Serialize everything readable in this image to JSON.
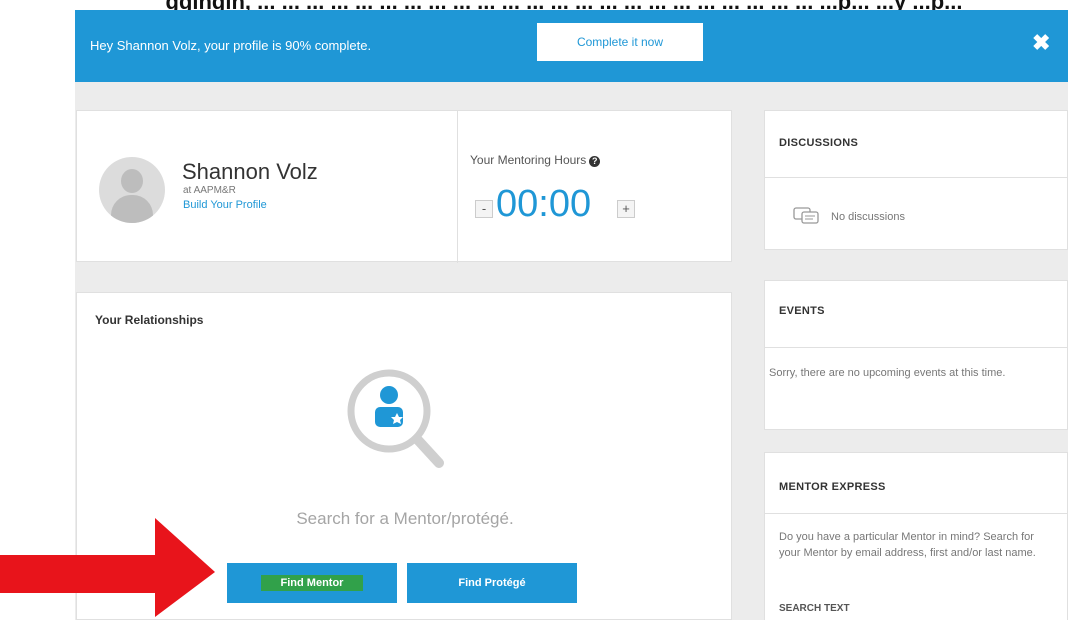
{
  "caption_fragment": "ggingin, ... ... ... ... ... ... ... ... ... ... ... ... ... ... ... ... ... ... ... ... ... ... ... ...p... ...y ...p...",
  "banner": {
    "message": "Hey Shannon Volz, your profile is 90% complete.",
    "cta_label": "Complete it now",
    "close_glyph": "✖",
    "color": "#1f97d6"
  },
  "profile": {
    "name": "Shannon Volz",
    "org": "at AAPM&R",
    "link": "Build Your Profile",
    "icon": "avatar-placeholder"
  },
  "mentoring_hours": {
    "label": "Your Mentoring Hours",
    "help_glyph": "?",
    "value": "00:00",
    "minus": "-",
    "plus": "+"
  },
  "relationships": {
    "title": "Your Relationships",
    "prompt": "Search for a Mentor/protégé.",
    "find_mentor_label": "Find Mentor",
    "find_protege_label": "Find Protégé",
    "highlight_color": "#31a14a"
  },
  "discussions": {
    "title": "DISCUSSIONS",
    "empty_text": "No discussions"
  },
  "events": {
    "title": "EVENTS",
    "empty_text": "Sorry, there are no upcoming events at this time."
  },
  "mentor_express": {
    "title": "MENTOR EXPRESS",
    "description": "Do you have a particular Mentor in mind? Search for your Mentor by email address, first and/or last name.",
    "search_label": "SEARCH TEXT"
  },
  "annotation": {
    "arrow_color": "#e8141b"
  }
}
